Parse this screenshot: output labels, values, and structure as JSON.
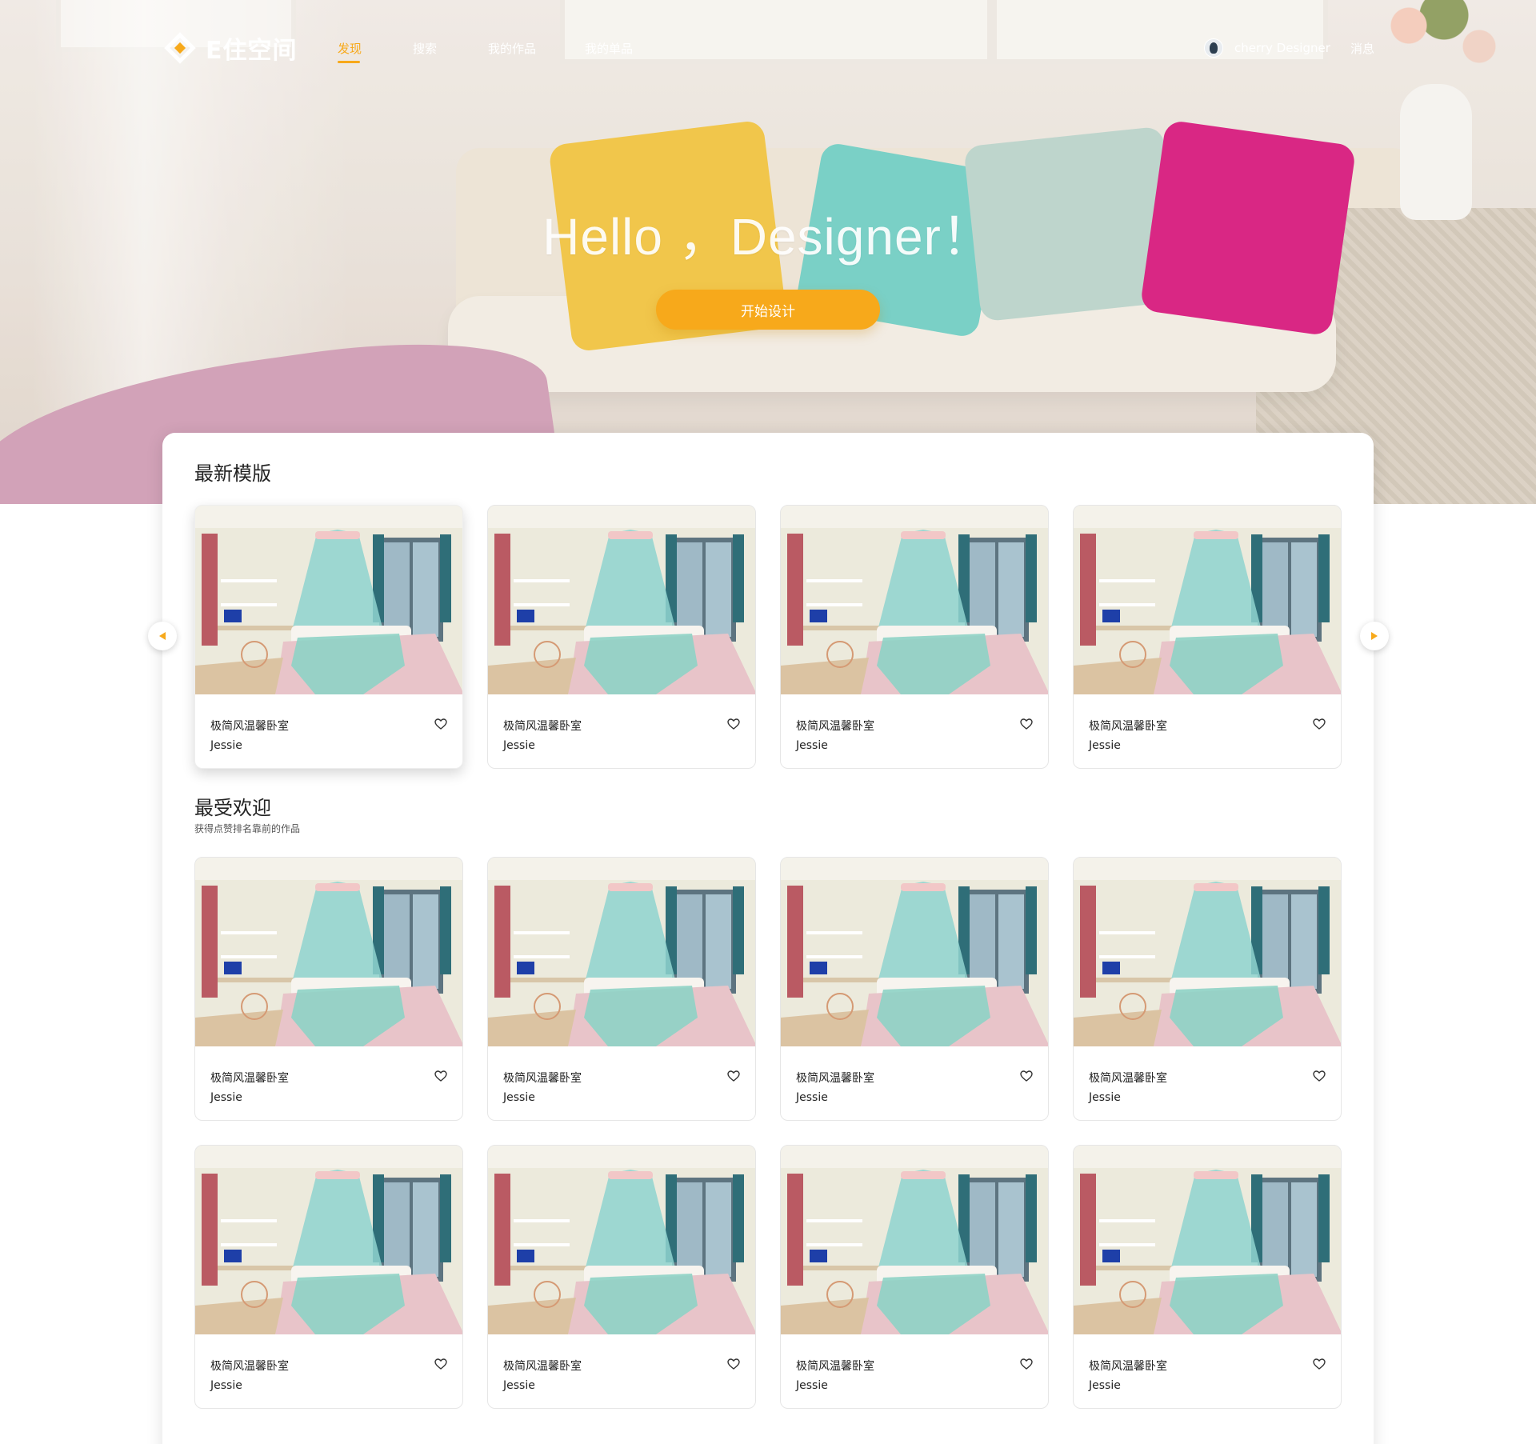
{
  "brand": {
    "name": "E住空间",
    "accent": "#f7a91b"
  },
  "nav": {
    "items": [
      {
        "label": "发现",
        "active": true
      },
      {
        "label": "搜索",
        "active": false
      },
      {
        "label": "我的作品",
        "active": false
      },
      {
        "label": "我的单品",
        "active": false
      }
    ],
    "user": {
      "name": "cherry Designer",
      "avatar_icon": "avatar-icon"
    },
    "message_label": "消息"
  },
  "hero": {
    "title": "Hello ，Designer！",
    "cta_label": "开始设计"
  },
  "sections": {
    "latest": {
      "title": "最新模版"
    },
    "popular": {
      "title": "最受欢迎",
      "subtitle": "获得点赞排名靠前的作品"
    }
  },
  "latest_cards": [
    {
      "name": "极简风温馨卧室",
      "author": "Jessie"
    },
    {
      "name": "极简风温馨卧室",
      "author": "Jessie"
    },
    {
      "name": "极简风温馨卧室",
      "author": "Jessie"
    },
    {
      "name": "极简风温馨卧室",
      "author": "Jessie"
    }
  ],
  "popular_cards": [
    {
      "name": "极简风温馨卧室",
      "author": "Jessie"
    },
    {
      "name": "极简风温馨卧室",
      "author": "Jessie"
    },
    {
      "name": "极简风温馨卧室",
      "author": "Jessie"
    },
    {
      "name": "极简风温馨卧室",
      "author": "Jessie"
    },
    {
      "name": "极简风温馨卧室",
      "author": "Jessie"
    },
    {
      "name": "极简风温馨卧室",
      "author": "Jessie"
    },
    {
      "name": "极简风温馨卧室",
      "author": "Jessie"
    },
    {
      "name": "极简风温馨卧室",
      "author": "Jessie"
    }
  ],
  "icons": {
    "like": "like-icon",
    "carousel_prev": "arrow-left-icon",
    "carousel_next": "arrow-right-icon"
  }
}
